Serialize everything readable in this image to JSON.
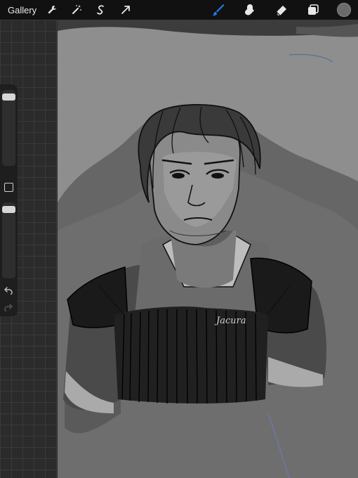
{
  "topbar": {
    "gallery_label": "Gallery",
    "left_tools": [
      "wrench-icon",
      "magic-wand-icon",
      "selection-icon",
      "transform-arrow-icon"
    ],
    "right_tools": [
      "brush-icon",
      "smudge-icon",
      "eraser-icon",
      "layers-icon"
    ],
    "active_tool": "brush-icon",
    "active_color": "#6b6b6b",
    "accent": "#1e7cf2"
  },
  "sidebar": {
    "brush_size_level": 0.05,
    "opacity_level": 0.05,
    "modify_button": "square-icon",
    "undo": "undo-icon",
    "redo": "redo-icon"
  },
  "canvas": {
    "signature": "Jacura"
  }
}
